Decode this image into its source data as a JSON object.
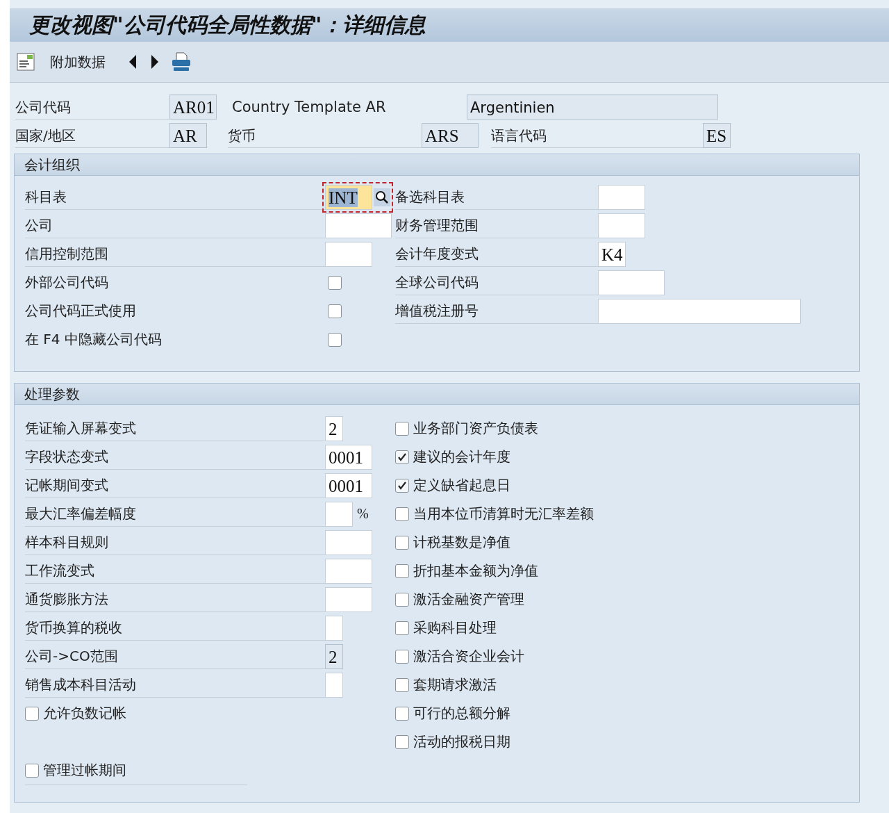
{
  "title": "更改视图\"公司代码全局性数据\"：详细信息",
  "toolbar": {
    "button": "附加数据"
  },
  "header": {
    "company_code": {
      "label": "公司代码",
      "value": "AR01",
      "readonly": true
    },
    "company_name": "Country Template AR",
    "city": {
      "value": "Argentinien",
      "readonly": true
    },
    "country": {
      "label": "国家/地区",
      "value": "AR",
      "readonly": true
    },
    "currency": {
      "label": "货币",
      "value": "ARS",
      "readonly": true
    },
    "language": {
      "label": "语言代码",
      "value": "ES",
      "readonly": true
    }
  },
  "accounting_org": {
    "title": "会计组织",
    "left": [
      {
        "kind": "field",
        "label": "科目表",
        "value": "INT",
        "readonly": false,
        "focused": true
      },
      {
        "kind": "field",
        "label": "公司",
        "readonly": false,
        "focused": false
      },
      {
        "kind": "field",
        "label": "信用控制范围",
        "readonly": false,
        "focused": false
      },
      {
        "kind": "flag",
        "label": "外部公司代码",
        "checked": false
      },
      {
        "kind": "flag",
        "label": "公司代码正式使用",
        "checked": false
      },
      {
        "kind": "flag",
        "label": "在 F4 中隐藏公司代码",
        "checked": false
      }
    ],
    "right": [
      {
        "kind": "field",
        "label": "备选科目表",
        "readonly": false,
        "focused": false
      },
      {
        "kind": "field",
        "label": "财务管理范围",
        "readonly": false,
        "focused": false
      },
      {
        "kind": "field",
        "label": "会计年度变式",
        "value": "K4",
        "readonly": false,
        "focused": false
      },
      {
        "kind": "field",
        "label": "全球公司代码",
        "readonly": false,
        "focused": false
      },
      {
        "kind": "field",
        "label": "增值税注册号",
        "readonly": false,
        "focused": false
      }
    ]
  },
  "processing": {
    "title": "处理参数",
    "left": [
      {
        "kind": "field",
        "label": "凭证输入屏幕变式",
        "value": "2",
        "readonly": false,
        "focused": false
      },
      {
        "kind": "field",
        "label": "字段状态变式",
        "value": "0001",
        "readonly": false,
        "focused": false
      },
      {
        "kind": "field",
        "label": "记帐期间变式",
        "value": "0001",
        "readonly": false,
        "focused": false
      },
      {
        "kind": "field",
        "label": "最大汇率偏差幅度",
        "unit": "%",
        "readonly": false,
        "focused": false
      },
      {
        "kind": "field",
        "label": "样本科目规则",
        "readonly": false,
        "focused": false
      },
      {
        "kind": "field",
        "label": "工作流变式",
        "readonly": false,
        "focused": false
      },
      {
        "kind": "field",
        "label": "通货膨胀方法",
        "readonly": false,
        "focused": false
      },
      {
        "kind": "field",
        "label": "货币换算的税收",
        "readonly": false,
        "focused": false
      },
      {
        "kind": "field",
        "label": "公司->CO范围",
        "value": "2",
        "readonly": true,
        "focused": false
      },
      {
        "kind": "field",
        "label": "销售成本科目活动",
        "readonly": false,
        "focused": false
      },
      {
        "kind": "option",
        "label": "允许负数记帐",
        "checked": false
      },
      {
        "kind": "option",
        "label": "管理过帐期间",
        "checked": false
      }
    ],
    "right": [
      {
        "kind": "option",
        "label": "业务部门资产负债表",
        "checked": false
      },
      {
        "kind": "option",
        "label": "建议的会计年度",
        "checked": true
      },
      {
        "kind": "option",
        "label": "定义缺省起息日",
        "checked": true
      },
      {
        "kind": "option",
        "label": "当用本位币清算时无汇率差额",
        "checked": false
      },
      {
        "kind": "option",
        "label": "计税基数是净值",
        "checked": false
      },
      {
        "kind": "option",
        "label": "折扣基本金额为净值",
        "checked": false
      },
      {
        "kind": "option",
        "label": "激活金融资产管理",
        "checked": false
      },
      {
        "kind": "option",
        "label": "采购科目处理",
        "checked": false
      },
      {
        "kind": "option",
        "label": "激活合资企业会计",
        "checked": false
      },
      {
        "kind": "option",
        "label": "套期请求激活",
        "checked": false
      },
      {
        "kind": "option",
        "label": "可行的总额分解",
        "checked": false
      },
      {
        "kind": "option",
        "label": "活动的报税日期",
        "checked": false
      }
    ]
  }
}
